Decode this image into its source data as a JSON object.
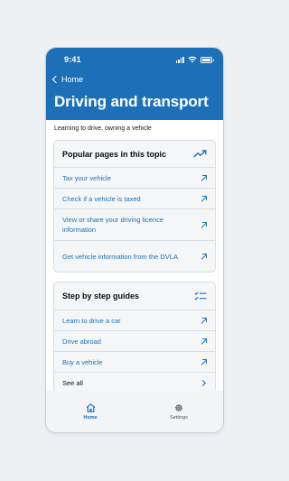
{
  "status_bar": {
    "time": "9:41"
  },
  "header": {
    "back_label": "Home",
    "title": "Driving and transport"
  },
  "subtitle": "Learning to drive, owning a vehicle",
  "popular": {
    "heading": "Popular pages in this topic",
    "icon": "trend-up-icon",
    "items": [
      {
        "label": "Tax your vehicle"
      },
      {
        "label": "Check if a vehicle is taxed"
      },
      {
        "label": "View or share your driving licence information"
      },
      {
        "label": "Get vehicle information from the DVLA"
      }
    ]
  },
  "guides": {
    "heading": "Step by step guides",
    "icon": "checklist-icon",
    "items": [
      {
        "label": "Learn to drive a car"
      },
      {
        "label": "Drive abroad"
      },
      {
        "label": "Buy a vehicle"
      }
    ],
    "see_all": "See all"
  },
  "tabbar": {
    "tabs": [
      {
        "label": "Home",
        "icon": "home-icon",
        "active": true
      },
      {
        "label": "Settings",
        "icon": "gear-icon",
        "active": false
      }
    ]
  },
  "colors": {
    "brand": "#1d70b8",
    "card_bg": "#f4f6f8",
    "page_bg": "#eef1f4"
  }
}
